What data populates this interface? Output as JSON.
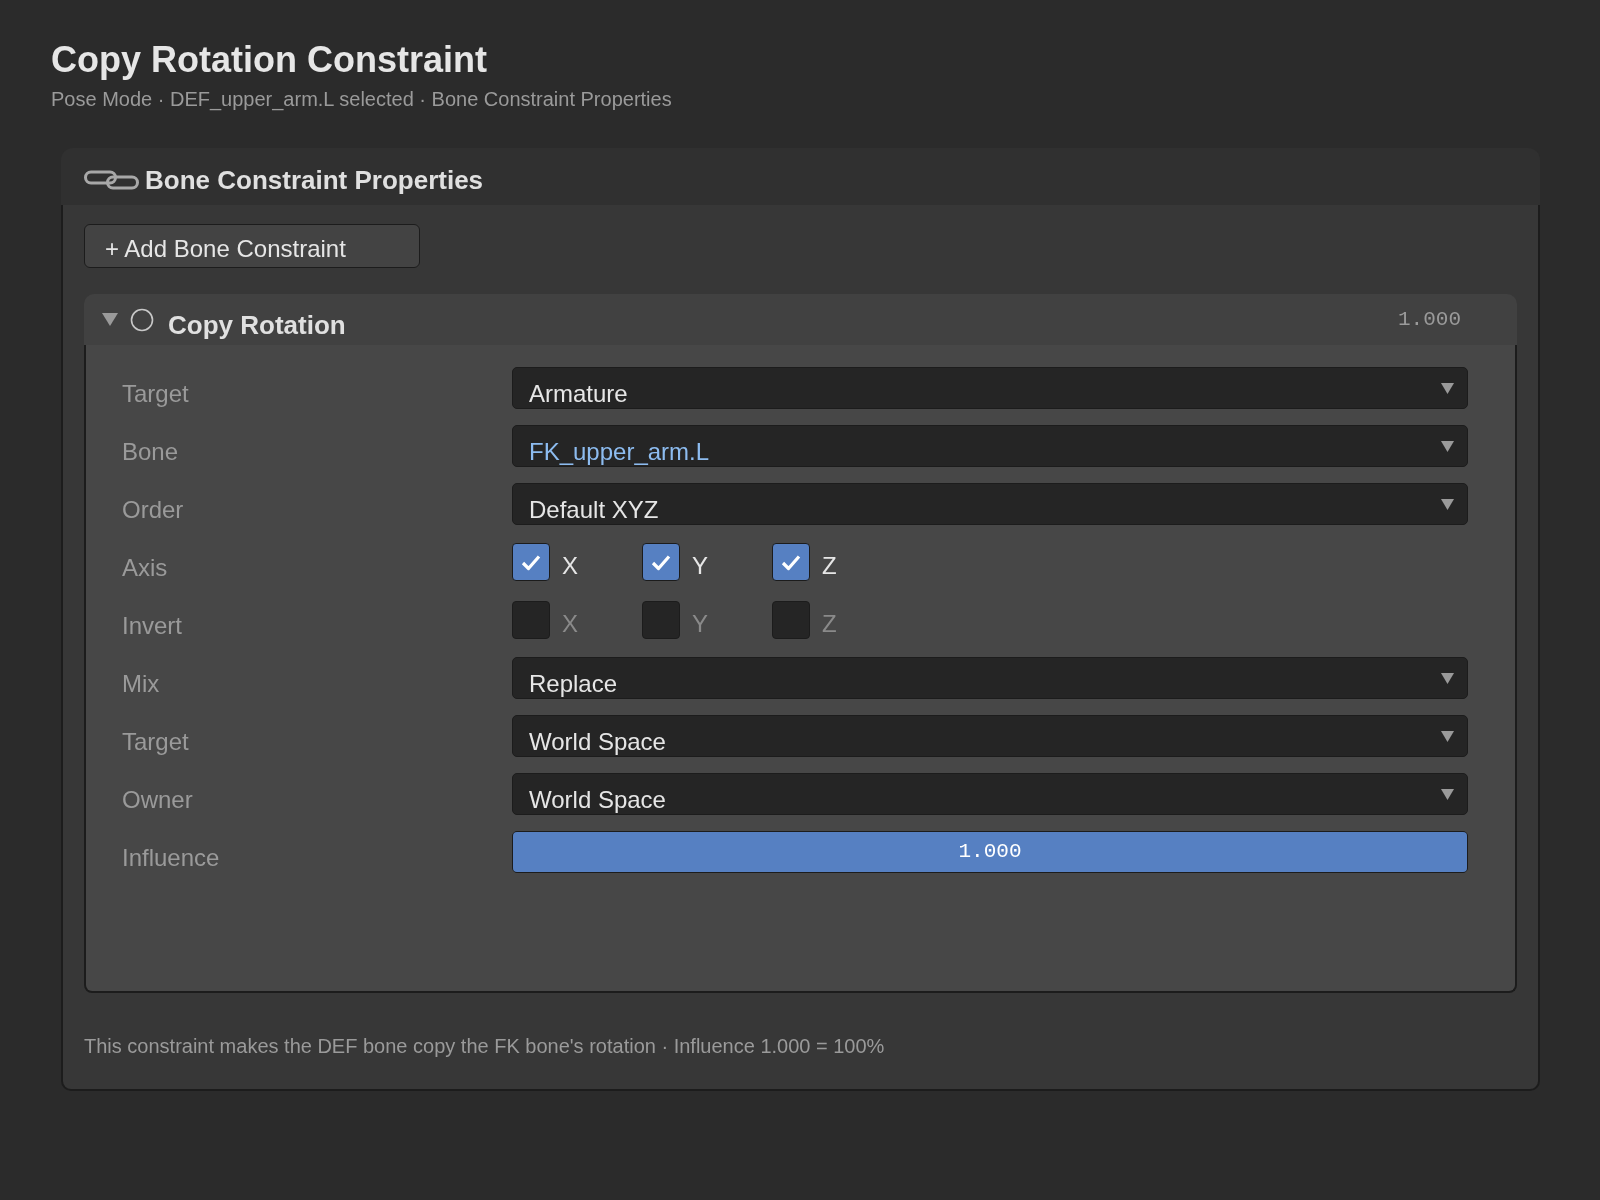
{
  "header": {
    "title": "Copy Rotation Constraint",
    "subtitle": "Pose Mode · DEF_upper_arm.L selected · Bone Constraint Properties"
  },
  "panel": {
    "title": "Bone Constraint Properties",
    "add_button": "+ Add Bone Constraint",
    "constraint": {
      "name": "Copy Rotation",
      "expanded": true,
      "value": "1.000",
      "rows": [
        {
          "kind": "dropdown",
          "label": "Target",
          "value": "Armature",
          "highlighted": false
        },
        {
          "kind": "dropdown",
          "label": "Bone",
          "value": "FK_upper_arm.L",
          "highlighted": true
        },
        {
          "kind": "dropdown",
          "label": "Order",
          "value": "Default XYZ",
          "highlighted": false
        },
        {
          "kind": "checkboxes",
          "label": "Axis",
          "options": [
            {
              "label": "X",
              "checked": true
            },
            {
              "label": "Y",
              "checked": true
            },
            {
              "label": "Z",
              "checked": true
            }
          ]
        },
        {
          "kind": "checkboxes",
          "label": "Invert",
          "options": [
            {
              "label": "X",
              "checked": false
            },
            {
              "label": "Y",
              "checked": false
            },
            {
              "label": "Z",
              "checked": false
            }
          ]
        },
        {
          "kind": "dropdown",
          "label": "Mix",
          "value": "Replace",
          "highlighted": false
        },
        {
          "kind": "dropdown",
          "label": "Target",
          "value": "World Space",
          "highlighted": false
        },
        {
          "kind": "dropdown",
          "label": "Owner",
          "value": "World Space",
          "highlighted": false
        },
        {
          "kind": "slider",
          "label": "Influence",
          "value": "1.000",
          "level": 1
        }
      ]
    },
    "note": "This constraint makes the DEF bone copy the FK bone's rotation · Influence 1.000 = 100%"
  }
}
